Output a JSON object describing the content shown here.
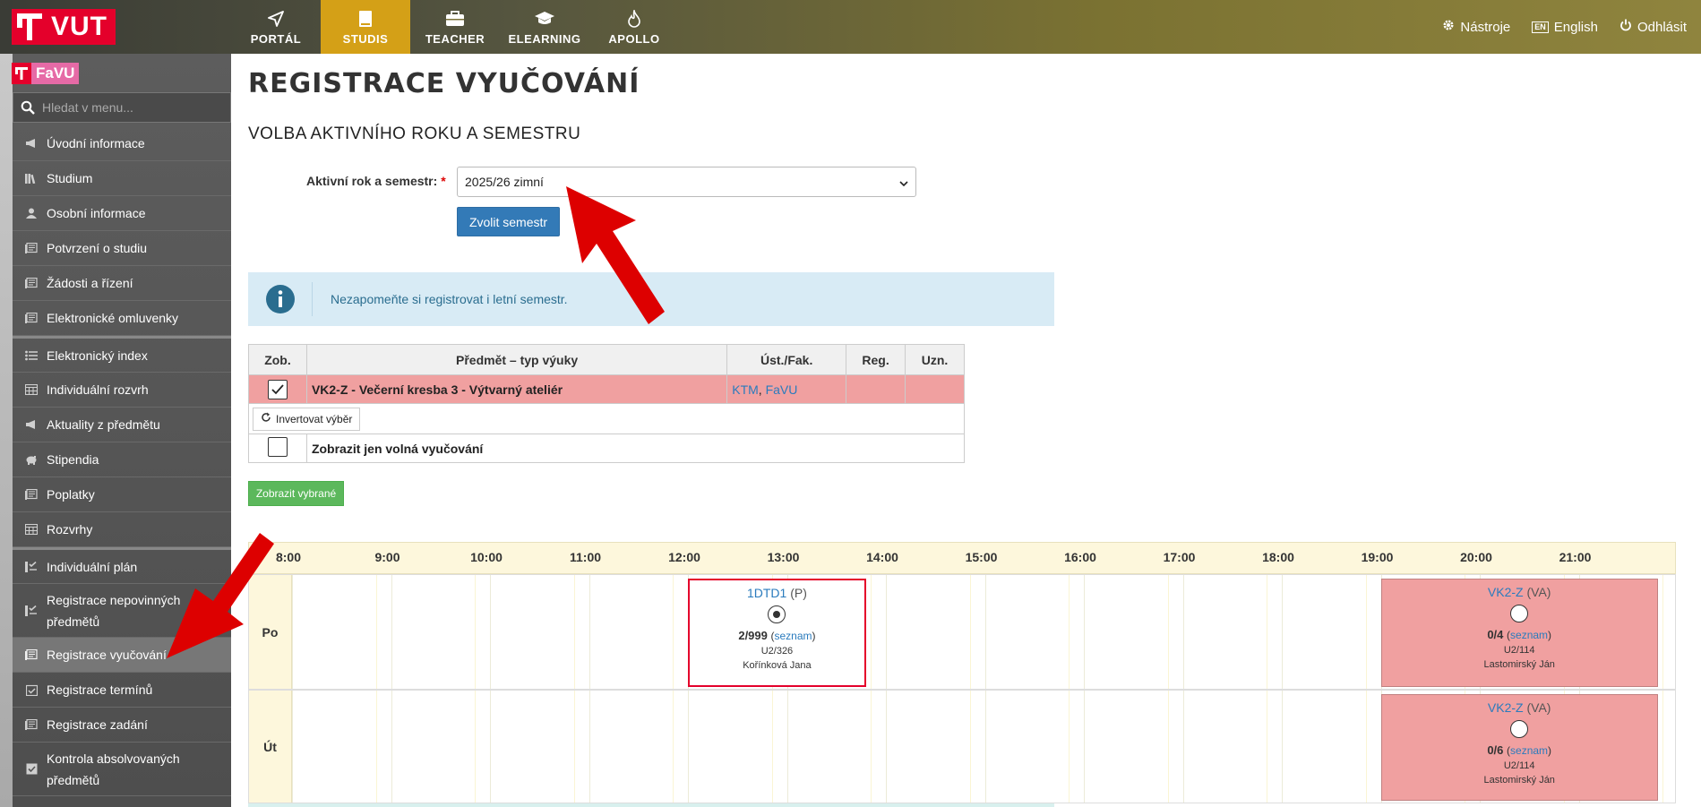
{
  "header": {
    "logo_text": "VUT",
    "nav": [
      {
        "label": "PORTÁL",
        "icon": "paper-plane-icon"
      },
      {
        "label": "STUDIS",
        "icon": "book-icon",
        "active": true
      },
      {
        "label": "TEACHER",
        "icon": "briefcase-icon"
      },
      {
        "label": "ELEARNING",
        "icon": "graduation-cap-icon"
      },
      {
        "label": "APOLLO",
        "icon": "flame-icon"
      }
    ],
    "tools_label": "Nástroje",
    "lang_badge": "EN",
    "lang_label": "English",
    "logout_label": "Odhlásit"
  },
  "sidebar": {
    "faculty": "FaVU",
    "search_placeholder": "Hledat v menu...",
    "items": [
      {
        "label": "Úvodní informace"
      },
      {
        "label": "Studium"
      },
      {
        "label": "Osobní informace"
      },
      {
        "label": "Potvrzení o studiu"
      },
      {
        "label": "Žádosti a řízení"
      },
      {
        "label": "Elektronické omluvenky"
      },
      {
        "label": "Elektronický index"
      },
      {
        "label": "Individuální rozvrh"
      },
      {
        "label": "Aktuality z předmětu"
      },
      {
        "label": "Stipendia"
      },
      {
        "label": "Poplatky"
      },
      {
        "label": "Rozvrhy"
      },
      {
        "label": "Individuální plán"
      },
      {
        "label": "Registrace nepovinných předmětů"
      },
      {
        "label": "Registrace vyučování",
        "active": true
      },
      {
        "label": "Registrace termínů"
      },
      {
        "label": "Registrace zadání"
      },
      {
        "label": "Kontrola absolvovaných předmětů"
      }
    ]
  },
  "main": {
    "title": "REGISTRACE VYUČOVÁNÍ",
    "section_title": "VOLBA AKTIVNÍHO ROKU A SEMESTRU",
    "semester_label": "Aktivní rok a semestr:",
    "required_mark": "*",
    "semester_value": "2025/26 zimní",
    "choose_button": "Zvolit semestr",
    "info_text": "Nezapomeňte si registrovat i letní semestr.",
    "table": {
      "headers": [
        "Zob.",
        "Předmět – typ výuky",
        "Úst./Fak.",
        "Reg.",
        "Uzn."
      ],
      "row": {
        "subject": "VK2-Z - Večerní kresba 3 - Výtvarný ateliér",
        "dept": "KTM",
        "faculty": "FaVU",
        "checked": true
      },
      "invert_label": "Invertovat výběr",
      "free_only_label": "Zobrazit jen volná vyučování"
    },
    "show_selected_button": "Zobrazit vybrané"
  },
  "timetable": {
    "hours": [
      "8:00",
      "9:00",
      "10:00",
      "11:00",
      "12:00",
      "13:00",
      "14:00",
      "15:00",
      "16:00",
      "17:00",
      "18:00",
      "19:00",
      "20:00",
      "21:00"
    ],
    "days": [
      {
        "label": "Po",
        "slots": [
          {
            "code": "1DTD1",
            "type": "(P)",
            "capacity": "2/999",
            "list_label": "seznam",
            "room": "U2/326",
            "teacher": "Kořínková Jana",
            "selected": true,
            "start": 12.0,
            "end": 13.8
          },
          {
            "code": "VK2-Z",
            "type": "(VA)",
            "capacity": "0/4",
            "list_label": "seznam",
            "room": "U2/114",
            "teacher": "Lastomirský Ján",
            "selected": false,
            "start": 19.0,
            "end": 21.8
          }
        ]
      },
      {
        "label": "Út",
        "slots": [
          {
            "code": "VK2-Z",
            "type": "(VA)",
            "capacity": "0/6",
            "list_label": "seznam",
            "room": "U2/114",
            "teacher": "Lastomirský Ján",
            "selected": false,
            "start": 19.0,
            "end": 21.8
          }
        ]
      }
    ]
  },
  "colors": {
    "accent_red": "#e4002b",
    "active_tab": "#d4a017",
    "highlight_row": "#f0a0a0",
    "primary_button": "#337ab7",
    "success_button": "#5cb85c",
    "info_bg": "#d8ebf5"
  }
}
